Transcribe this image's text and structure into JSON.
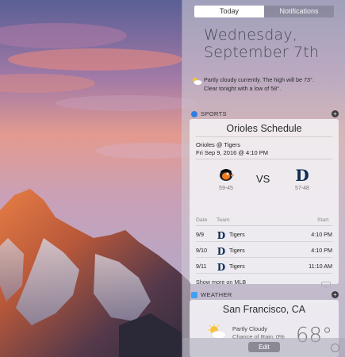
{
  "tabs": {
    "today": "Today",
    "notifications": "Notifications"
  },
  "date": {
    "weekday": "Wednesday,",
    "monthday": "September 7th"
  },
  "summary": {
    "line1": "Partly cloudy currently. The high will be 73°.",
    "line2": "Clear tonight with a low of 58°."
  },
  "sports": {
    "header": "SPORTS",
    "title": "Orioles Schedule",
    "matchup": "Orioles @ Tigers",
    "datetime": "Fri Sep 9, 2016 @ 4:10 PM",
    "away_record": "59-45",
    "vs": "VS",
    "home_record": "57-48",
    "columns": {
      "date": "Date",
      "team": "Team",
      "start": "Start"
    },
    "rows": [
      {
        "date": "9/9",
        "team": "Tigers",
        "start": "4:10 PM"
      },
      {
        "date": "9/10",
        "team": "Tigers",
        "start": "4:10 PM"
      },
      {
        "date": "9/11",
        "team": "Tigers",
        "start": "11:10 AM"
      }
    ],
    "more": "Show more on MLB"
  },
  "weather": {
    "header": "WEATHER",
    "city": "San Francisco, CA",
    "condition": "Partly Cloudy",
    "rain": "Chance of Rain: 0%",
    "temp": "68°"
  },
  "footer": {
    "edit": "Edit"
  },
  "colors": {
    "orioles": "#f47b20",
    "tigers": "#0c2c56",
    "sports_icon": "#2f7de1",
    "weather_icon": "#3fa1f3"
  }
}
